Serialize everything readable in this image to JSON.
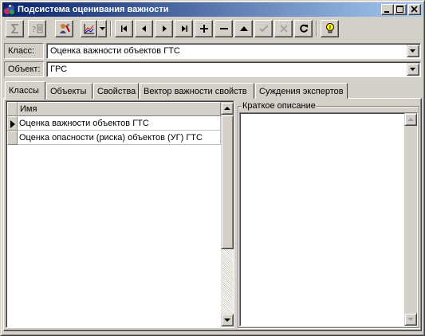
{
  "window": {
    "title": "Подсистема оценивания важности"
  },
  "toolbar": {
    "buttons": [
      "sum-icon",
      "question-list-icon",
      "user-settings-icon",
      "chart-icon",
      "first-record-icon",
      "prior-record-icon",
      "next-record-icon",
      "last-record-icon",
      "insert-record-icon",
      "delete-record-icon",
      "edit-record-icon",
      "post-record-icon",
      "cancel-record-icon",
      "refresh-icon",
      "hint-lightbulb-icon"
    ]
  },
  "fields": {
    "class_label": "Класс:",
    "class_value": "Оценка важности объектов ГТС",
    "object_label": "Объект:",
    "object_value": "ГРС"
  },
  "tabs": [
    {
      "label": "Классы",
      "active": true
    },
    {
      "label": "Объекты",
      "active": false
    },
    {
      "label": "Свойства",
      "active": false
    },
    {
      "label": "Вектор важности свойств",
      "active": false
    },
    {
      "label": "Суждения экспертов",
      "active": false
    }
  ],
  "grid": {
    "column_header": "Имя",
    "rows": [
      {
        "name": "Оценка важности объектов ГТС",
        "current": true
      },
      {
        "name": "Оценка опасности (риска) объектов (УГ) ГТС",
        "current": false
      }
    ]
  },
  "description": {
    "label": "Краткое описание",
    "text": ""
  },
  "colors": {
    "face": "#d4d0c8",
    "title_gradient_start": "#0a246a",
    "title_gradient_end": "#a6caf0",
    "lightbulb": "#ffff00"
  }
}
